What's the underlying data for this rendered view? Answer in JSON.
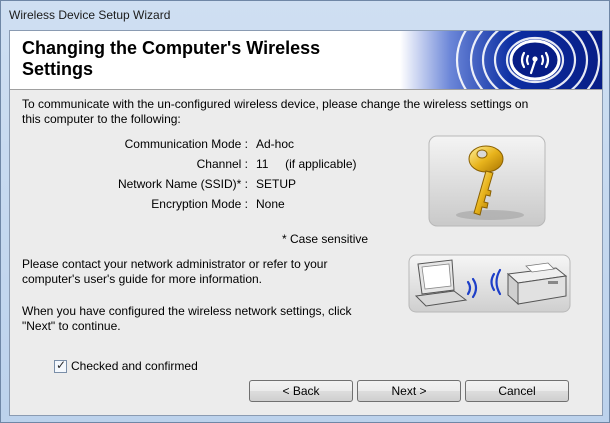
{
  "window": {
    "title": "Wireless Device Setup Wizard"
  },
  "header": {
    "title_line1": "Changing the Computer's Wireless",
    "title_line2": "Settings"
  },
  "body": {
    "intro_line1": "To communicate with the un-configured wireless device, please change the wireless settings on",
    "intro_line2": "this computer to the following:",
    "settings": [
      {
        "label": "Communication Mode :",
        "value": "Ad-hoc"
      },
      {
        "label": "Channel :",
        "value": "11     (if applicable)"
      },
      {
        "label": "Network Name (SSID)* :",
        "value": "SETUP"
      },
      {
        "label": "Encryption Mode :",
        "value": "None"
      }
    ],
    "case_note": "* Case sensitive",
    "contact_line1": "Please contact your network administrator or refer to your",
    "contact_line2": "computer's user's guide for more information.",
    "configured_line1": "When you have configured the wireless network settings, click",
    "configured_line2": "\"Next\" to continue."
  },
  "confirm": {
    "label": "Checked and confirmed",
    "checked": true
  },
  "buttons": {
    "back": "< Back",
    "next": "Next >",
    "cancel": "Cancel"
  },
  "icons": {
    "banner": "wireless-logo-icon",
    "key": "key-icon",
    "devices": "laptop-printer-wireless-icon"
  },
  "colors": {
    "banner_blue": "#0a2a9c",
    "key_gold": "#e8b41c"
  }
}
